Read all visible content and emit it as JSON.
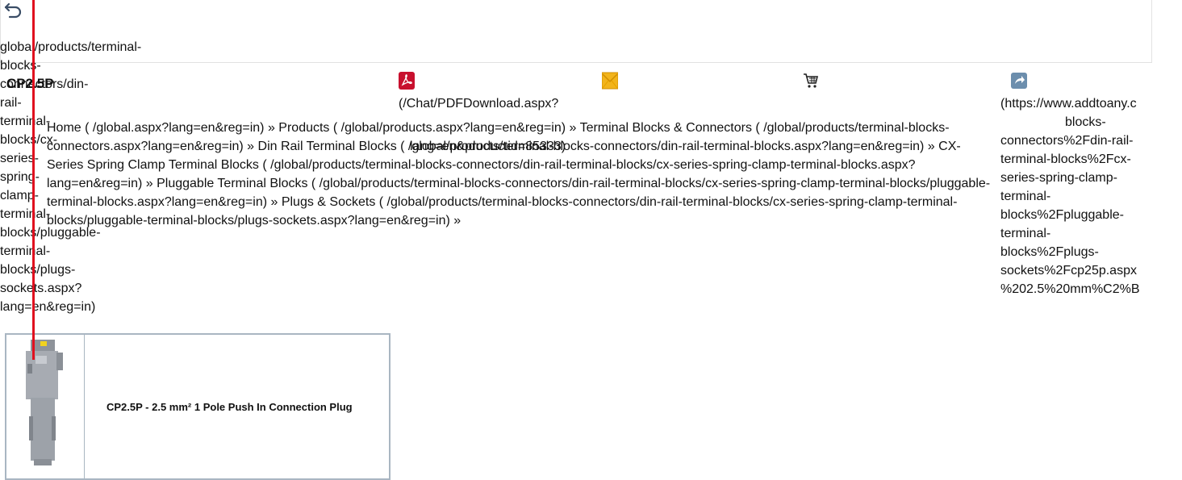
{
  "path_fragments": "global/products/terminal-\nblocks-\nconnectors/din-\nrail-\nterminal-\nblocks/cx-\nseries-\nspring-\nclamp-\nterminal-\nblocks/pluggable-\nterminal-\nblocks/plugs-\nsockets.aspx?\nlang=en&reg=in)",
  "product_title": "CP2.5P",
  "actions": {
    "pdf_icon": "pdf-icon",
    "mail_icon": "mail-icon",
    "cart_icon": "cart-icon",
    "share_icon": "share-icon",
    "pdf_link_text": "(/Chat/PDFDownload.aspx?",
    "share_link_text": "(https://www.addtoany.c\n                  blocks-\nconnectors%2Fdin-rail-\nterminal-blocks%2Fcx-\nseries-spring-clamp-\nterminal-\nblocks%2Fpluggable-\nterminal-\nblocks%2Fplugs-\nsockets%2Fcp25p.aspx\n%202.5%20mm%C2%B"
  },
  "breadcrumb_text": "Home ( /global.aspx?lang=en&reg=in) » Products ( /global/products.aspx?lang=en&reg=in) » Terminal Blocks & Connectors ( /global/products/terminal-blocks-\nconnectors.aspx?lang=en&reg=in) » Din Rail Terminal Blocks ( /global/products/terminal-blocks-connectors/din-rail-terminal-blocks.aspx?lang=en&reg=in) » CX-\nSeries Spring Clamp Terminal Blocks ( /global/products/terminal-blocks-connectors/din-rail-terminal-blocks/cx-series-spring-clamp-terminal-blocks.aspx?\nlang=en&reg=in) » Pluggable Terminal Blocks ( /global/products/terminal-blocks-connectors/din-rail-terminal-blocks/cx-series-spring-clamp-terminal-blocks/pluggable-\nterminal-blocks.aspx?lang=en&reg=in) » Plugs & Sockets ( /global/products/terminal-blocks-connectors/din-rail-terminal-blocks/cx-series-spring-clamp-terminal-\nblocks/pluggable-terminal-blocks/plugs-sockets.aspx?lang=en&reg=in) »",
  "overlap_text": "lang=en&productid=85333)",
  "product_card": {
    "name": "CP2.5P - 2.5 mm² 1 Pole Push In Connection Plug"
  },
  "colors": {
    "accent_red": "#e0101f",
    "card_border": "#a9b6c2",
    "mail_icon": "#f2b41b",
    "pdf_icon": "#c8102e"
  }
}
